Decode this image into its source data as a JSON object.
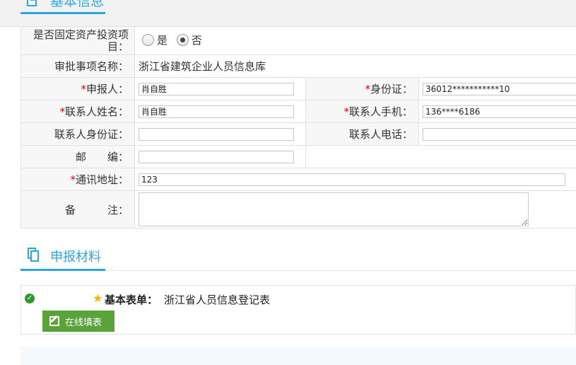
{
  "header": {
    "section_title": "基本信息"
  },
  "form": {
    "fixed_asset_label": "是否固定资产投资项目：",
    "fixed_asset_label_line1": "是否固定资产投资项",
    "fixed_asset_label_line2": "目：",
    "fixed_asset_options": [
      "是",
      "否"
    ],
    "fixed_asset_selected": "否",
    "approval_item_label": "审批事项名称：",
    "approval_item_value": "浙江省建筑企业人员信息库",
    "applicant_label": "申报人：",
    "applicant_value": "肖自胜",
    "id_card_label": "身份证：",
    "id_card_value": "36012***********10",
    "contact_name_label": "联系人姓名：",
    "contact_name_value": "肖自胜",
    "contact_mobile_label": "联系人手机：",
    "contact_mobile_value": "136****6186",
    "contact_id_label": "联系人身份证：",
    "contact_id_value": "",
    "contact_phone_label": "联系人电话：",
    "contact_phone_value": "",
    "postcode_label": "邮　　编：",
    "postcode_value": "",
    "address_label": "通讯地址：",
    "address_value": "123",
    "remark_label": "备　　　注：",
    "remark_value": "",
    "required_mark": "*"
  },
  "materials": {
    "section_title": "申报材料",
    "item_label": "基本表单：",
    "item_value": "浙江省人员信息登记表",
    "fill_button": "在线填表"
  },
  "colors": {
    "accent": "#2ba6de",
    "required": "#e60012",
    "button": "#5aa33a",
    "check": "#2e9a2e",
    "star": "#f5b400"
  }
}
